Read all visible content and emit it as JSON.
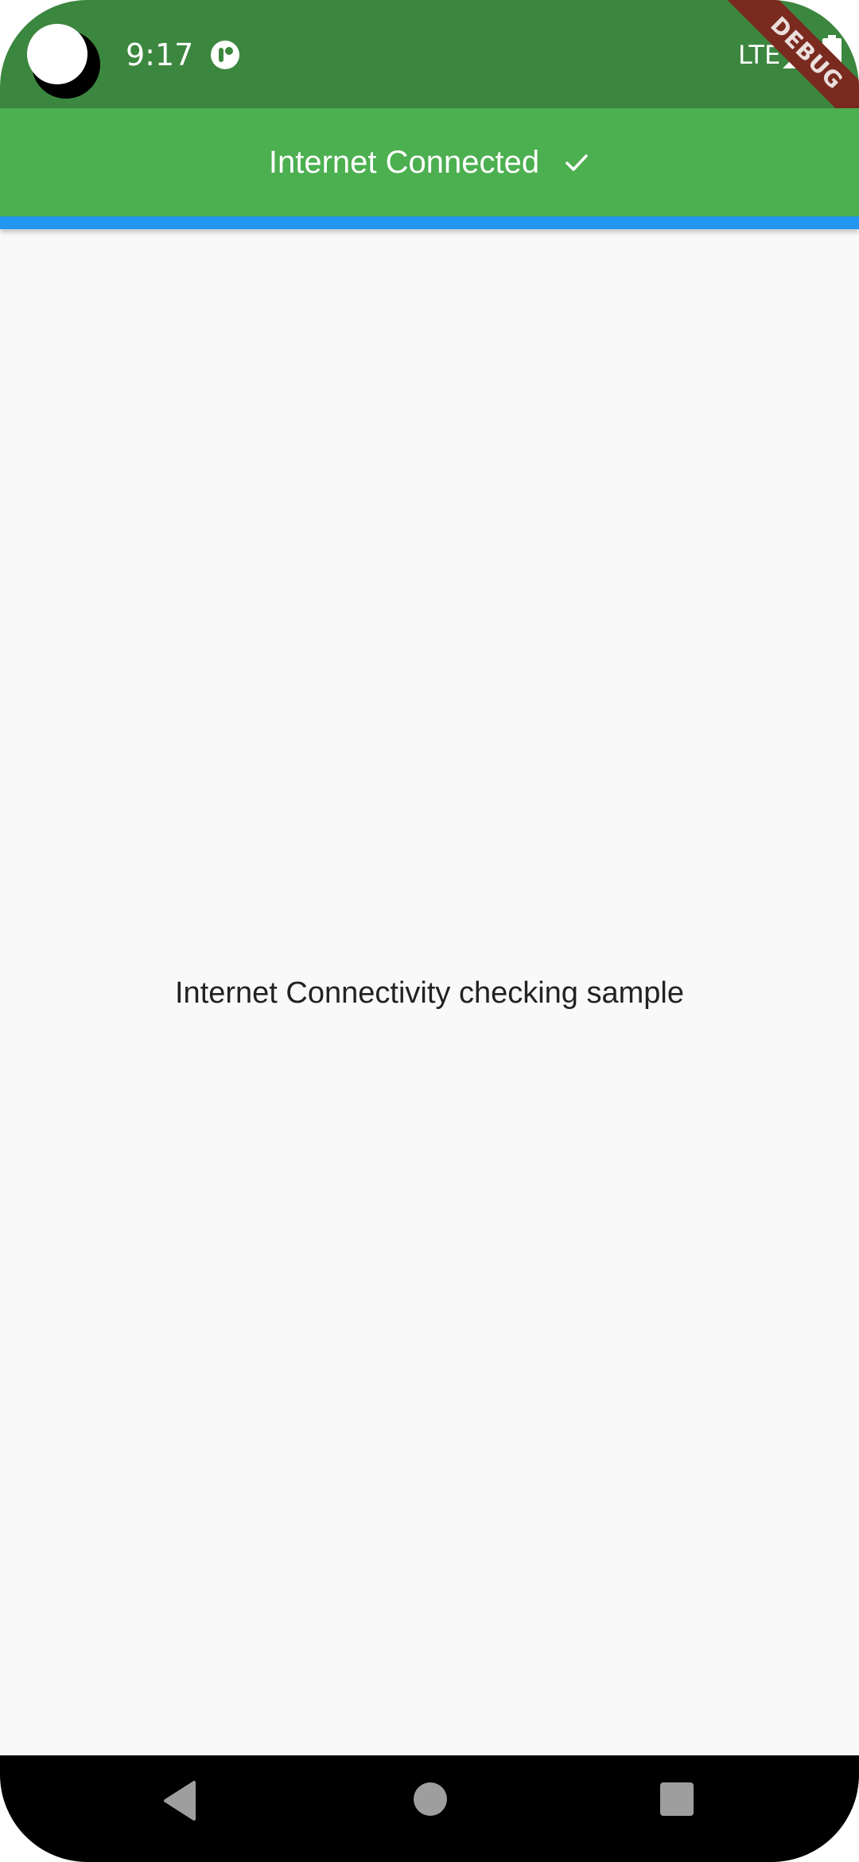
{
  "status_bar": {
    "time": "9:17",
    "network": "LTE",
    "app_icon": "app-status-icon",
    "signal_icon": "signal-icon",
    "battery_icon": "battery-icon"
  },
  "debug_banner": {
    "label": "DEBUG"
  },
  "app_bar": {
    "title": "Internet Connected",
    "icon": "check-icon",
    "background": "#4caf50",
    "accent": "#2196f3"
  },
  "main": {
    "message": "Internet Connectivity checking sample"
  },
  "nav_bar": {
    "back_icon": "back-icon",
    "home_icon": "home-icon",
    "recents_icon": "recents-icon"
  }
}
